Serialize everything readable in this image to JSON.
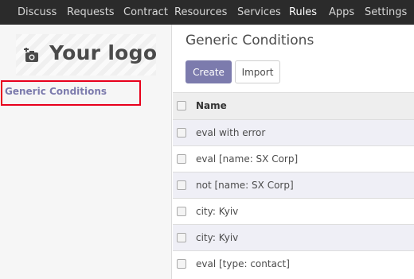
{
  "topbar": {
    "items": [
      {
        "label": "Discuss"
      },
      {
        "label": "Requests"
      },
      {
        "label": "Contract"
      },
      {
        "label": "Resources"
      },
      {
        "label": "Services"
      },
      {
        "label": "Rules",
        "active": true
      },
      {
        "label": "Apps"
      },
      {
        "label": "Settings"
      }
    ]
  },
  "sidebar": {
    "logo_text": "Your logo",
    "logo_icon": "camera-plus-icon",
    "items": [
      {
        "label": "Generic Conditions",
        "selected": true
      }
    ]
  },
  "main": {
    "title": "Generic Conditions",
    "create_label": "Create",
    "import_label": "Import",
    "table": {
      "columns": [
        "Name"
      ],
      "rows": [
        {
          "name": "eval with error"
        },
        {
          "name": "eval [name: SX Corp]"
        },
        {
          "name": "not [name: SX Corp]"
        },
        {
          "name": "city: Kyiv"
        },
        {
          "name": "city: Kyiv"
        },
        {
          "name": "eval [type: contact]"
        }
      ]
    }
  },
  "colors": {
    "topbar_bg": "#2b2b2b",
    "accent": "#7c7bad",
    "highlight": "#e8001c",
    "odd_row": "#efeff6"
  }
}
